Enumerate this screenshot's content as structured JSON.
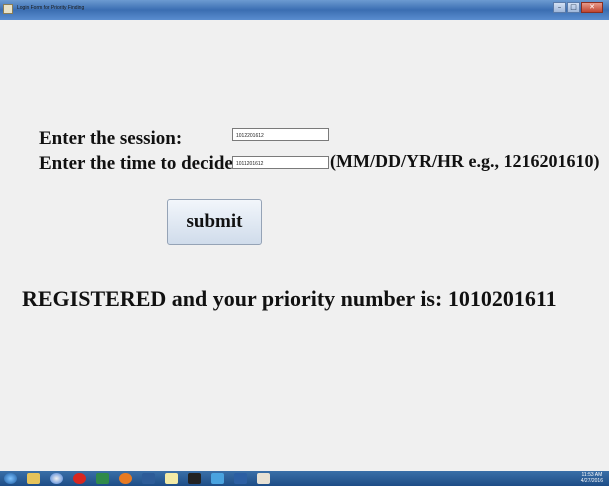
{
  "window": {
    "title": "Login Form for Priority Finding"
  },
  "form": {
    "session_label": "Enter the session:",
    "session_value": "1012201612",
    "time_label": "Enter the time to decide:",
    "time_value": "1011201612",
    "format_hint": "(MM/DD/YR/HR e.g., 1216201610)",
    "submit_label": "submit"
  },
  "result": {
    "message": "REGISTERED and your priority number is: 1010201611"
  },
  "taskbar": {
    "icons": [
      "start-orb",
      "explorer",
      "chrome",
      "opera",
      "excel",
      "firefox",
      "netbeans",
      "notepad",
      "cmd",
      "network",
      "word",
      "java"
    ],
    "clock_time": "11:53 AM",
    "clock_date": "4/27/2016"
  }
}
